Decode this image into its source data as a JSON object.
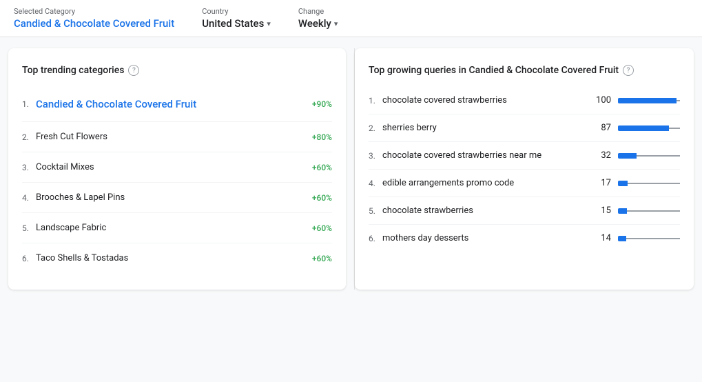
{
  "header": {
    "selected_category_label": "Selected Category",
    "selected_category_value": "Candied & Chocolate Covered Fruit",
    "country_label": "Country",
    "country_value": "United States",
    "change_label": "Change",
    "change_value": "Weekly"
  },
  "left_card": {
    "title": "Top trending categories",
    "items": [
      {
        "rank": "1.",
        "name": "Candied & Chocolate Covered Fruit",
        "change": "+90%",
        "highlight": true
      },
      {
        "rank": "2.",
        "name": "Fresh Cut Flowers",
        "change": "+80%",
        "highlight": false
      },
      {
        "rank": "3.",
        "name": "Cocktail Mixes",
        "change": "+60%",
        "highlight": false
      },
      {
        "rank": "4.",
        "name": "Brooches & Lapel Pins",
        "change": "+60%",
        "highlight": false
      },
      {
        "rank": "5.",
        "name": "Landscape Fabric",
        "change": "+60%",
        "highlight": false
      },
      {
        "rank": "6.",
        "name": "Taco Shells & Tostadas",
        "change": "+60%",
        "highlight": false
      }
    ]
  },
  "right_card": {
    "title": "Top growing queries in Candied & Chocolate Covered Fruit",
    "queries": [
      {
        "rank": "1.",
        "name": "chocolate covered strawberries",
        "score": 100,
        "bar_pct": 100
      },
      {
        "rank": "2.",
        "name": "sherries berry",
        "score": 87,
        "bar_pct": 87
      },
      {
        "rank": "3.",
        "name": "chocolate covered strawberries near me",
        "score": 32,
        "bar_pct": 32
      },
      {
        "rank": "4.",
        "name": "edible arrangements promo code",
        "score": 17,
        "bar_pct": 17
      },
      {
        "rank": "5.",
        "name": "chocolate strawberries",
        "score": 15,
        "bar_pct": 15
      },
      {
        "rank": "6.",
        "name": "mothers day desserts",
        "score": 14,
        "bar_pct": 14
      }
    ]
  },
  "icons": {
    "info": "?",
    "chevron_down": "▾"
  }
}
